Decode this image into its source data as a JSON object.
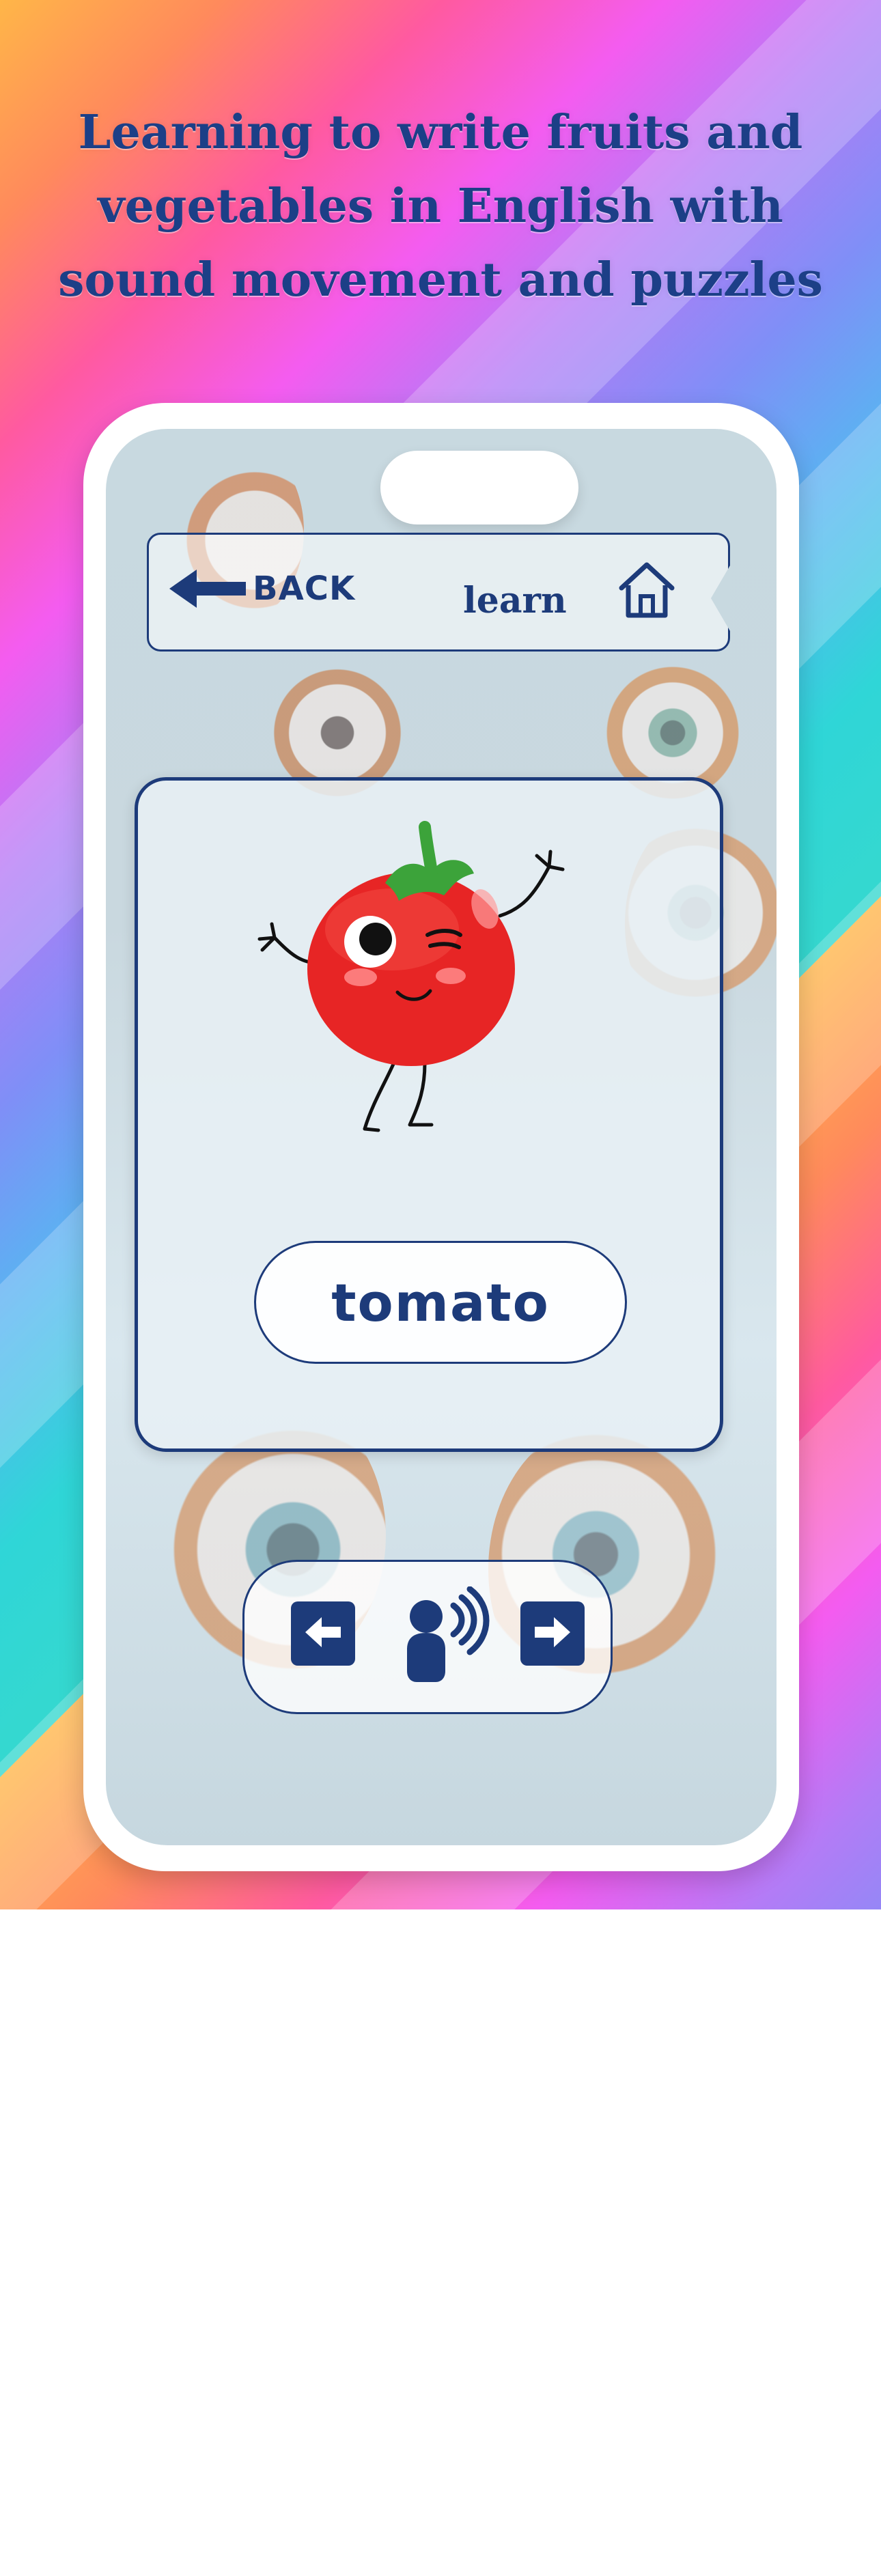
{
  "promo": {
    "headline_line1": "Learning to write fruits and",
    "headline_line2": "vegetables in English with",
    "headline_line3": "sound movement and puzzles"
  },
  "topbar": {
    "back_label": "BACK",
    "title": "learn",
    "home_icon": "home-icon",
    "back_icon": "back-arrow-icon"
  },
  "card": {
    "word": "tomato",
    "image": "tomato-character-illustration"
  },
  "controls": {
    "prev_icon": "arrow-left-icon",
    "speak_icon": "speaking-person-icon",
    "next_icon": "arrow-right-icon"
  },
  "colors": {
    "primary": "#1d3b7a",
    "tomato_red": "#e72525",
    "leaf_green": "#3ca33a"
  }
}
